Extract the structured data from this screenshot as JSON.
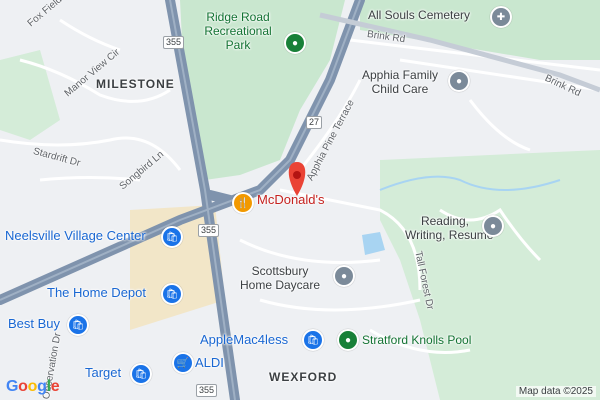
{
  "map": {
    "places": {
      "ridge_road_park": "Ridge Road\nRecreational\nPark",
      "all_souls_cemetery": "All Souls Cemetery",
      "apphia_child_care": "Apphia Family\nChild Care",
      "mcdonalds": "McDonald's",
      "neelsville_village_center": "Neelsville Village Center",
      "home_depot": "The Home Depot",
      "best_buy": "Best Buy",
      "target": "Target",
      "aldi": "ALDI",
      "scottsbury_home_daycare": "Scottsbury\nHome Daycare",
      "applemac4less": "AppleMac4less",
      "stratford_knolls_pool": "Stratford Knolls Pool",
      "reading_writing_resume": "Reading,\nWriting, Resume"
    },
    "areas": {
      "milestone": "MILESTONE",
      "wexford": "WEXFORD"
    },
    "streets": {
      "fox_field_cir": "Fox Field Cir",
      "manor_view_cir": "Manor View Cir",
      "stardrift_dr": "Stardrift Dr",
      "songbird_ln": "Songbird Ln",
      "brink_rd_1": "Brink Rd",
      "brink_rd_2": "Brink Rd",
      "apphia_pine_terrace": "Apphia Pine Terrace",
      "tall_forest_dr": "Tall Forest Dr",
      "observation_dr": "Observation Dr"
    },
    "route_shields": {
      "r355_top": "355",
      "r355_bottom": "355",
      "r27": "27",
      "r355_lower": "355"
    },
    "attribution": "Map data ©2025",
    "logo": "Google",
    "colors": {
      "park": "#c9e7cf",
      "highway": "#7f93ad",
      "water": "#a8d4f2",
      "commercial": "#f2e6c8",
      "marker": "#ea4335"
    }
  }
}
